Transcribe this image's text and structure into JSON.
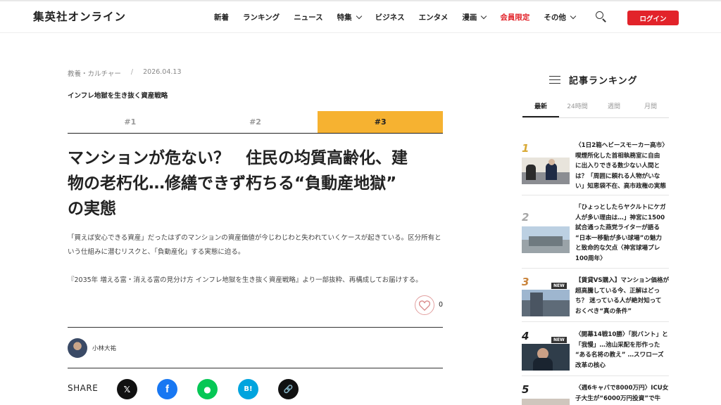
{
  "header": {
    "logo": "集英社オンライン",
    "nav": [
      {
        "label": "新着",
        "dropdown": false
      },
      {
        "label": "ランキング",
        "dropdown": false
      },
      {
        "label": "ニュース",
        "dropdown": false
      },
      {
        "label": "特集",
        "dropdown": true
      },
      {
        "label": "ビジネス",
        "dropdown": false
      },
      {
        "label": "エンタメ",
        "dropdown": false
      },
      {
        "label": "漫画",
        "dropdown": true
      },
      {
        "label": "会員限定",
        "dropdown": false,
        "highlight": true
      },
      {
        "label": "その他",
        "dropdown": true
      }
    ],
    "search_icon": "search-icon",
    "login_label": "ログイン"
  },
  "article": {
    "category": "教養・カルチャー",
    "meta_sep": "/",
    "date": "2026.04.13",
    "series_title": "インフレ地獄を生き抜く資産戦略",
    "tabs": [
      {
        "label": "#1",
        "active": false
      },
      {
        "label": "#2",
        "active": false
      },
      {
        "label": "#3",
        "active": true
      }
    ],
    "title_lines": [
      "マンションが危ない？　住民の均質高齢化、建",
      "物の老朽化…修繕できず朽ちる“負動産地獄”",
      "の実態"
    ],
    "lead_lines": [
      "「買えば安心できる資産」だったはずのマンションの資産価値が今じわじわと失われていくケースが起きている。区分所有と",
      "いう仕組みに潜むリスクと、「負動産化」する実態に迫る。"
    ],
    "source_note": "『2035年 増える富・消える富の見分け方 インフレ地獄を生き抜く資産戦略』より一部抜粋、再構成してお届けする。",
    "like_count": "0",
    "author": "小林大祐",
    "share_label": "SHARE",
    "share_buttons": [
      {
        "name": "x-share-button",
        "glyph": "𝕏",
        "color": "#111111"
      },
      {
        "name": "facebook-share-button",
        "glyph": "f",
        "color": "#1877f2"
      },
      {
        "name": "line-share-button",
        "glyph": "●",
        "color": "#06c755"
      },
      {
        "name": "hatena-share-button",
        "glyph": "B!",
        "color": "#00a4de"
      },
      {
        "name": "copy-link-button",
        "glyph": "🔗",
        "color": "#111111"
      }
    ]
  },
  "sidebar": {
    "title": "記事ランキング",
    "tabs": [
      {
        "label": "最新",
        "active": true
      },
      {
        "label": "24時間",
        "active": false
      },
      {
        "label": "週間",
        "active": false
      },
      {
        "label": "月間",
        "active": false
      }
    ],
    "items": [
      {
        "rank": "1",
        "rank_color": "#d9a934",
        "new": false,
        "lines": [
          "〈1日2箱ヘビースモーカー高市〉",
          "喫煙所化した首相執務室に自由",
          "に出入りできる数少ない人間と",
          "は？「周囲に頼れる人物がいな",
          "い」知恵袋不在、高市政権の実態"
        ]
      },
      {
        "rank": "2",
        "rank_color": "#a7a7a7",
        "new": false,
        "lines": [
          "「ひょっとしたらヤクルトにケガ",
          "人が多い理由は…」神宮に1500",
          "試合通った燕党ライターが語る",
          "“日本一移動が多い球場”の魅力",
          "と致命的な欠点〈神宮球場プレ",
          "100周年〉"
        ]
      },
      {
        "rank": "3",
        "rank_color": "#c9843c",
        "new": true,
        "new_label": "NEW",
        "lines": [
          "【賃貸VS購入】マンション価格が",
          "超高騰している今、正解はどっ",
          "ち？ 迷っている人が絶対知って",
          "おくべき“真の条件”"
        ]
      },
      {
        "rank": "4",
        "rank_color": "#222222",
        "new": true,
        "new_label": "NEW",
        "lines": [
          "〈開幕14戦10勝〉「脱バント」と",
          "「我慢」…池山采配を形作った",
          "“ある名将の教え” …スワローズ",
          "改革の核心"
        ]
      },
      {
        "rank": "5",
        "rank_color": "#222222",
        "new": false,
        "lines": [
          "〈週6キャバで8000万円〉ICU女",
          "子大生が“6000万円投資”で牛"
        ]
      }
    ]
  }
}
